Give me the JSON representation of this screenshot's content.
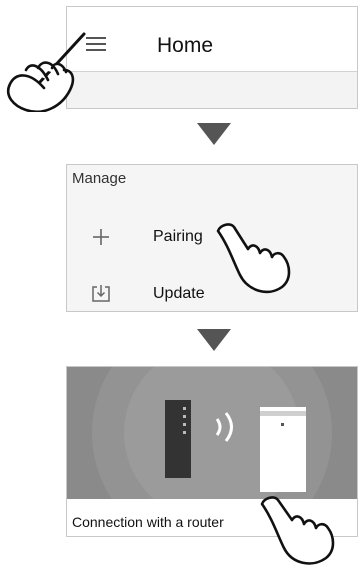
{
  "home": {
    "title": "Home",
    "menu_icon": "hamburger-menu-icon"
  },
  "manage": {
    "section_label": "Manage",
    "items": [
      {
        "label": "Pairing",
        "icon": "plus-icon"
      },
      {
        "label": "Update",
        "icon": "download-box-icon"
      }
    ]
  },
  "router": {
    "caption": "Connection with a router",
    "illustration": "router-wifi-device-icon"
  },
  "gesture": {
    "icon": "tap-hand-icon"
  },
  "colors": {
    "arrow": "#555555",
    "panel_border": "#c8c8c8",
    "illustration_bg": "#8a8a8a"
  }
}
